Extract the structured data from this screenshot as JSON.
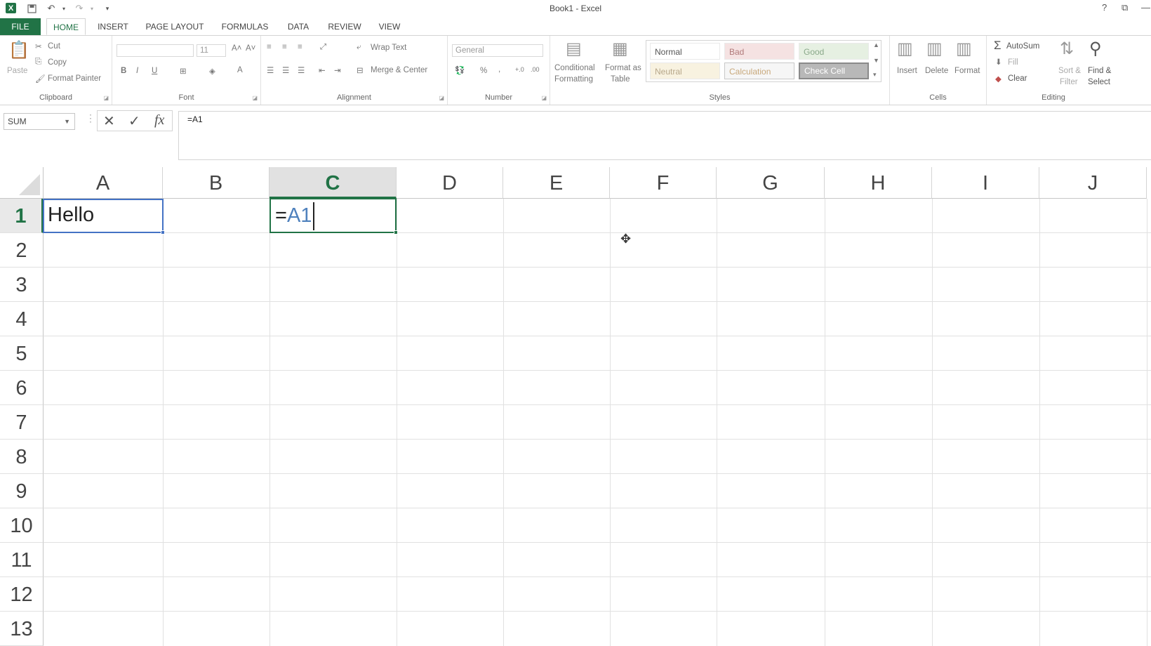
{
  "window": {
    "title": "Book1 - Excel",
    "help": "?",
    "restore": "⧉",
    "minimize": "—"
  },
  "qat": {
    "logo": "X"
  },
  "tabs": [
    {
      "label": "FILE"
    },
    {
      "label": "HOME"
    },
    {
      "label": "INSERT"
    },
    {
      "label": "PAGE LAYOUT"
    },
    {
      "label": "FORMULAS"
    },
    {
      "label": "DATA"
    },
    {
      "label": "REVIEW"
    },
    {
      "label": "VIEW"
    }
  ],
  "ribbon": {
    "clipboard": {
      "label": "Clipboard",
      "paste": "Paste",
      "cut": "Cut",
      "copy": "Copy",
      "format_painter": "Format Painter"
    },
    "font": {
      "label": "Font",
      "size": "11",
      "bold": "B",
      "italic": "I",
      "underline": "U"
    },
    "alignment": {
      "label": "Alignment",
      "wrap_text": "Wrap Text",
      "merge_center": "Merge & Center"
    },
    "number": {
      "label": "Number",
      "format": "General",
      "percent": "%",
      "comma": ","
    },
    "styles": {
      "label": "Styles",
      "conditional_1": "Conditional",
      "conditional_2": "Formatting",
      "format_as_1": "Format as",
      "format_as_2": "Table",
      "normal": "Normal",
      "bad": "Bad",
      "good": "Good",
      "neutral": "Neutral",
      "calculation": "Calculation",
      "check_cell": "Check Cell"
    },
    "cells": {
      "label": "Cells",
      "insert": "Insert",
      "delete": "Delete",
      "format": "Format"
    },
    "editing": {
      "label": "Editing",
      "autosum": "AutoSum",
      "fill": "Fill",
      "clear": "Clear",
      "sort_1": "Sort &",
      "sort_2": "Filter",
      "find_1": "Find &",
      "find_2": "Select"
    }
  },
  "formula_bar": {
    "name_box": "SUM",
    "fx": "fx",
    "value": "=A1"
  },
  "grid": {
    "columns": [
      "A",
      "B",
      "C",
      "D",
      "E",
      "F",
      "G",
      "H",
      "I",
      "J"
    ],
    "rows": [
      "1",
      "2",
      "3",
      "4",
      "5",
      "6",
      "7",
      "8",
      "9",
      "10",
      "11",
      "12",
      "13"
    ],
    "a1_value": "Hello",
    "c1_edit_eq": "=",
    "c1_edit_ref": "A1"
  },
  "colors": {
    "accent": "#217346",
    "ref_blue": "#4472c4"
  }
}
